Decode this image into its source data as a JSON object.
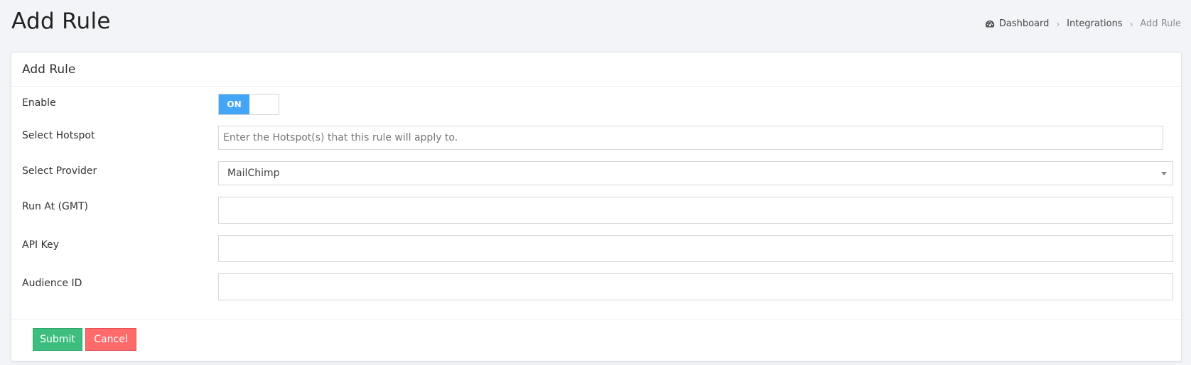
{
  "header": {
    "title": "Add Rule",
    "breadcrumb": [
      {
        "label": "Dashboard",
        "icon": "dashboard-icon"
      },
      {
        "label": "Integrations"
      },
      {
        "label": "Add Rule"
      }
    ]
  },
  "card": {
    "title": "Add Rule",
    "fields": {
      "enable": {
        "label": "Enable",
        "toggle_text": "ON"
      },
      "hotspot": {
        "label": "Select Hotspot",
        "placeholder": "Enter the Hotspot(s) that this rule will apply to.",
        "value": ""
      },
      "provider": {
        "label": "Select Provider",
        "selected": "MailChimp"
      },
      "run_at": {
        "label": "Run At (GMT)",
        "value": ""
      },
      "api_key": {
        "label": "API Key",
        "value": ""
      },
      "audience_id": {
        "label": "Audience ID",
        "value": ""
      }
    },
    "buttons": {
      "submit": "Submit",
      "cancel": "Cancel"
    }
  },
  "colors": {
    "toggle_on": "#42a5f5",
    "submit": "#3dbe7f",
    "cancel": "#ff6b6b"
  }
}
